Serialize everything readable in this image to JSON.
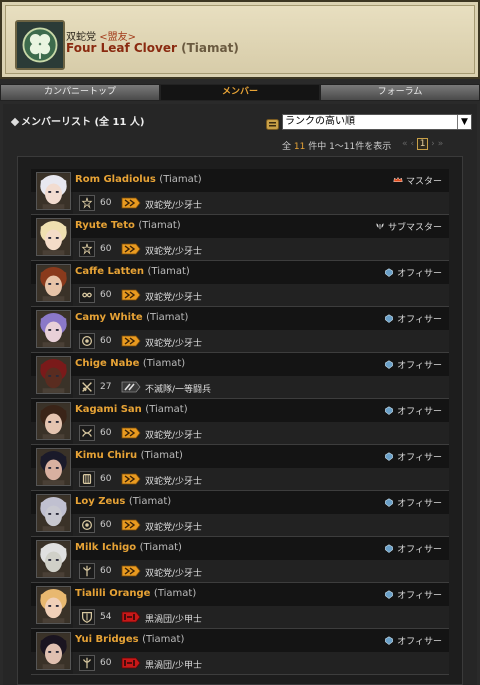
{
  "header": {
    "company_tag_prefix": "双蛇党",
    "company_tag": "<盟友>",
    "fc_name": "Four Leaf Clover",
    "fc_world": "(Tiamat)"
  },
  "tabs": [
    "カンパニートップ",
    "メンバー",
    "フォーラム"
  ],
  "member_list": {
    "title": "メンバーリスト (全 11 人)",
    "sort_selected": "ランクの高い順",
    "pager_prefix": "全",
    "pager_count": "11",
    "pager_suffix": "件中 1〜11件を表示",
    "current_page": "1"
  },
  "colors": {
    "accent": "#e7a336",
    "serpent": "#f0a020",
    "flame": "#c8201a",
    "maelstrom": "#d02020"
  },
  "members": [
    {
      "name": "Rom Gladiolus",
      "world": "(Tiamat)",
      "rank": "マスター",
      "rank_icon": "crown-icon",
      "job_icon": "ninja-icon",
      "level": "60",
      "gc": "serpent",
      "gc_rank": "双蛇党/少牙士",
      "skin": "#f2dcd0",
      "hair": "#e8e8f0"
    },
    {
      "name": "Ryute Teto",
      "world": "(Tiamat)",
      "rank": "サブマスター",
      "rank_icon": "shield-wing-icon",
      "job_icon": "ninja-icon",
      "level": "60",
      "gc": "serpent",
      "gc_rank": "双蛇党/少牙士",
      "skin": "#f4dcc8",
      "hair": "#f0e0b0"
    },
    {
      "name": "Caffe Latten",
      "world": "(Tiamat)",
      "rank": "オフィサー",
      "rank_icon": "officer-icon",
      "job_icon": "bard-icon",
      "level": "60",
      "gc": "serpent",
      "gc_rank": "双蛇党/少牙士",
      "skin": "#e8c4a8",
      "hair": "#8a3a1c"
    },
    {
      "name": "Camy White",
      "world": "(Tiamat)",
      "rank": "オフィサー",
      "rank_icon": "officer-icon",
      "job_icon": "summoner-icon",
      "level": "60",
      "gc": "serpent",
      "gc_rank": "双蛇党/少牙士",
      "skin": "#e8d0d8",
      "hair": "#8a78c8"
    },
    {
      "name": "Chige Nabe",
      "world": "(Tiamat)",
      "rank": "オフィサー",
      "rank_icon": "officer-icon",
      "job_icon": "warrior-icon",
      "level": "27",
      "gc": "flame",
      "gc_rank": "不滅隊/一等闘兵",
      "skin": "#5a2c20",
      "hair": "#7a1a1a"
    },
    {
      "name": "Kagami San",
      "world": "(Tiamat)",
      "rank": "オフィサー",
      "rank_icon": "officer-icon",
      "job_icon": "dragoon-icon",
      "level": "60",
      "gc": "serpent",
      "gc_rank": "双蛇党/少牙士",
      "skin": "#e4c4b0",
      "hair": "#3a2418"
    },
    {
      "name": "Kimu Chiru",
      "world": "(Tiamat)",
      "rank": "オフィサー",
      "rank_icon": "officer-icon",
      "job_icon": "monk-icon",
      "level": "60",
      "gc": "serpent",
      "gc_rank": "双蛇党/少牙士",
      "skin": "#d8b0a0",
      "hair": "#1a1a2a"
    },
    {
      "name": "Loy Zeus",
      "world": "(Tiamat)",
      "rank": "オフィサー",
      "rank_icon": "officer-icon",
      "job_icon": "summoner-icon",
      "level": "60",
      "gc": "serpent",
      "gc_rank": "双蛇党/少牙士",
      "skin": "#c8c8d0",
      "hair": "#c0c0d0"
    },
    {
      "name": "Milk Ichigo",
      "world": "(Tiamat)",
      "rank": "オフィサー",
      "rank_icon": "officer-icon",
      "job_icon": "astrologian-icon",
      "level": "60",
      "gc": "serpent",
      "gc_rank": "双蛇党/少牙士",
      "skin": "#d0d0c8",
      "hair": "#e0e0e0"
    },
    {
      "name": "Tialili Orange",
      "world": "(Tiamat)",
      "rank": "オフィサー",
      "rank_icon": "officer-icon",
      "job_icon": "paladin-icon",
      "level": "54",
      "gc": "maelstrom",
      "gc_rank": "黒渦団/少甲士",
      "skin": "#f0d0b8",
      "hair": "#e8b870"
    },
    {
      "name": "Yui Bridges",
      "world": "(Tiamat)",
      "rank": "オフィサー",
      "rank_icon": "officer-icon",
      "job_icon": "astrologian-icon",
      "level": "60",
      "gc": "maelstrom",
      "gc_rank": "黒渦団/少甲士",
      "skin": "#e0c0b0",
      "hair": "#1a1420"
    }
  ]
}
